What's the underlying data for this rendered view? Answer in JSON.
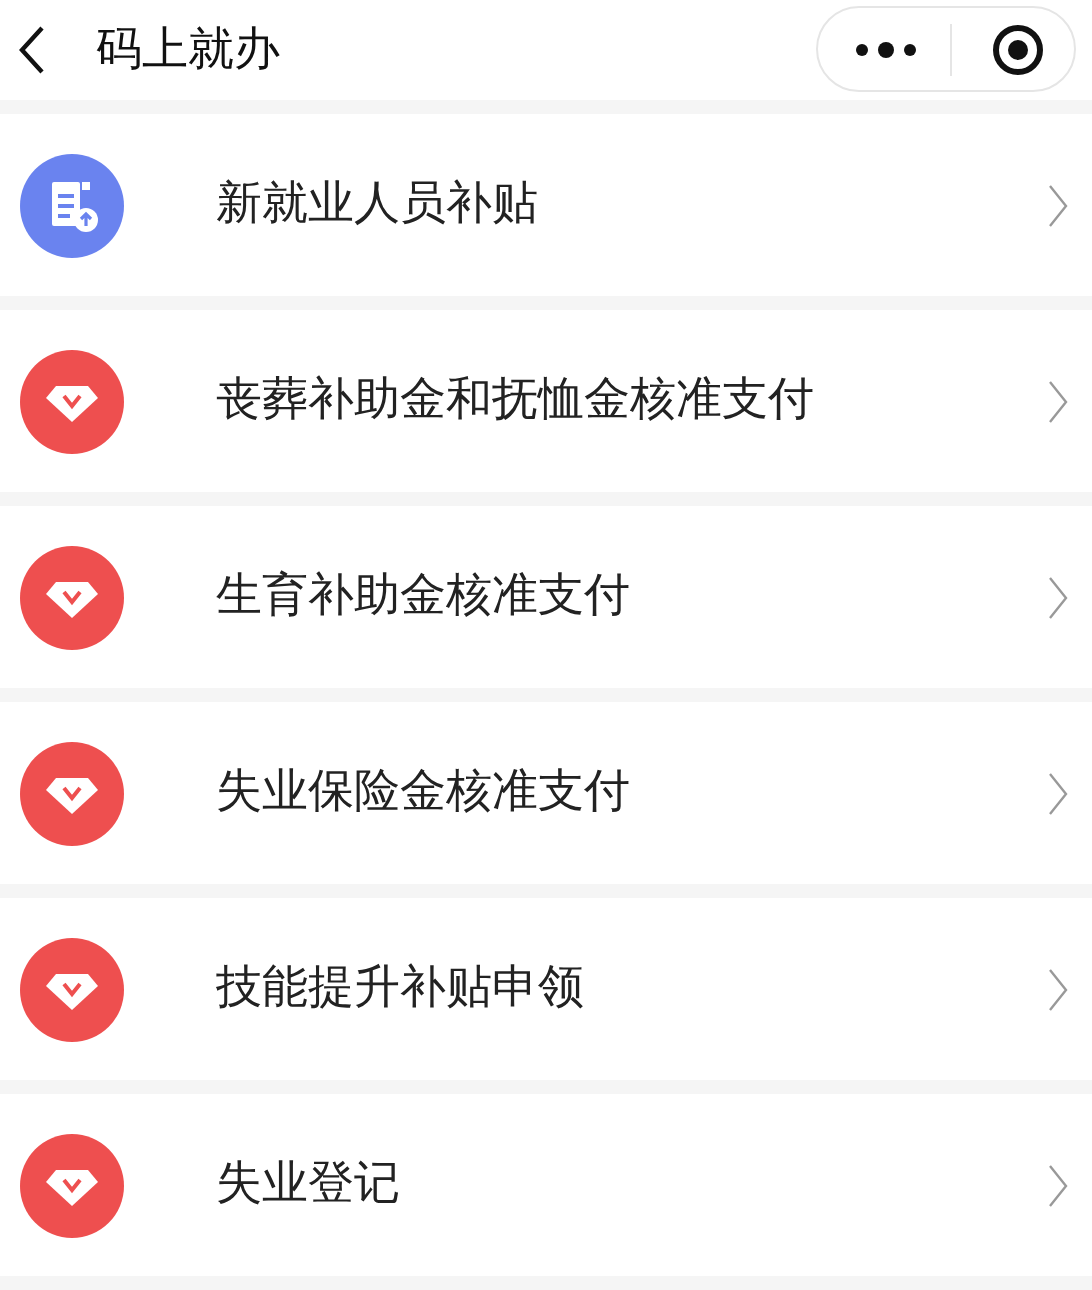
{
  "header": {
    "title": "码上就办"
  },
  "items": [
    {
      "kind": "document",
      "label": "新就业人员补贴"
    },
    {
      "kind": "diamond",
      "label": "丧葬补助金和抚恤金核准支付"
    },
    {
      "kind": "diamond",
      "label": "生育补助金核准支付"
    },
    {
      "kind": "diamond",
      "label": "失业保险金核准支付"
    },
    {
      "kind": "diamond",
      "label": "技能提升补贴申领"
    },
    {
      "kind": "diamond",
      "label": "失业登记"
    }
  ]
}
